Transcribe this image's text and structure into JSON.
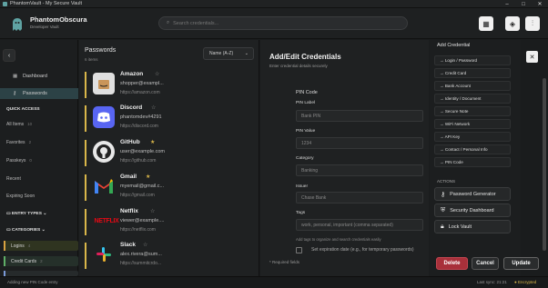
{
  "window": {
    "title": "PhantomVault - My Secure Vault",
    "minimize": "–",
    "maximize": "□",
    "close": "✕"
  },
  "app": {
    "name": "PhantomObscura",
    "subtitle": "Developer Vault"
  },
  "search": {
    "placeholder": "Search credentials..."
  },
  "sidebar": {
    "back": "‹",
    "nav": [
      {
        "label": "Dashboard",
        "icon": "grid-icon"
      },
      {
        "label": "Passwords",
        "icon": "key-icon"
      }
    ],
    "quick_access_heading": "QUICK ACCESS",
    "quick": [
      {
        "label": "All Items",
        "count": "10"
      },
      {
        "label": "Favorites",
        "count": "2"
      },
      {
        "label": "Passkeys",
        "count": "0"
      }
    ],
    "recent": "Recent",
    "expiring": "Expiring Soon",
    "entry_types": "ENTRY TYPES",
    "categories": "CATEGORIES",
    "category_items": [
      {
        "label": "Logins",
        "count": "4",
        "color": "#d9a341"
      },
      {
        "label": "Credit Cards",
        "count": "2",
        "color": "#5fae67"
      }
    ]
  },
  "list": {
    "title": "Passwords",
    "count": "6 items",
    "sort": "Name (A-Z)",
    "entries": [
      {
        "name": "Amazon",
        "user": "shopper@exampl...",
        "url": "https://amazon.com",
        "fav": "☆",
        "icon": "amazon-icon"
      },
      {
        "name": "Discord",
        "user": "phantomdev#4291",
        "url": "https://discord.com",
        "fav": "☆",
        "icon": "discord-icon"
      },
      {
        "name": "GitHub",
        "user": "user@example.com",
        "url": "https://github.com",
        "fav": "★",
        "icon": "github-icon"
      },
      {
        "name": "Gmail",
        "user": "myemail@gmail.c...",
        "url": "https://gmail.com",
        "fav": "★",
        "icon": "gmail-icon"
      },
      {
        "name": "Netflix",
        "user": "viewer@example....",
        "url": "https://netflix.com",
        "fav": "☆",
        "icon": "netflix-icon"
      },
      {
        "name": "Slack",
        "user": "alex.rivera@sum...",
        "url": "https://summitcrdo...",
        "fav": "☆",
        "icon": "slack-icon"
      }
    ]
  },
  "editor": {
    "title": "Add/Edit Credentials",
    "subtitle": "Enter credential details securely",
    "section": "PIN Code",
    "fields": [
      {
        "label": "PIN Label",
        "value": "Bank PIN"
      },
      {
        "label": "PIN Value",
        "value": "1234"
      },
      {
        "label": "Category",
        "value": "Banking"
      },
      {
        "label": "Issuer",
        "value": "Chase Bank"
      },
      {
        "label": "Tags",
        "value": "work, personal, important (comma separated)"
      }
    ],
    "tags_help": "Add tags to organize and search credentials easily",
    "expiry_label": "Set expiration date (e.g., for temporary passwords)",
    "required_note": "* Required fields",
    "delete": "Delete",
    "cancel": "Cancel",
    "update": "Update"
  },
  "menu": {
    "title": "Add Credential",
    "items": [
      "→ Login / Password",
      "→ Credit Card",
      "→ Bank Account",
      "→ Identity / Document",
      "→ Secure Note",
      "→ WiFi Network",
      "→ API Key",
      "→ Contact / Personal Info",
      "→ PIN Code"
    ],
    "actions_heading": "ACTIONS",
    "actions": [
      {
        "label": "Password Generator",
        "icon": "key-icon"
      },
      {
        "label": "Security Dashboard",
        "icon": "shield-icon"
      },
      {
        "label": "Lock Vault",
        "icon": "lock-icon"
      }
    ],
    "close": "✕"
  },
  "status": {
    "left": "Adding new PIN Code entry",
    "sync": "Last sync: 21:21",
    "encrypted": "Encrypted"
  },
  "colors": {
    "accent": "#d9b64a",
    "delete": "#a8303a",
    "active_nav": "#2c4246"
  }
}
